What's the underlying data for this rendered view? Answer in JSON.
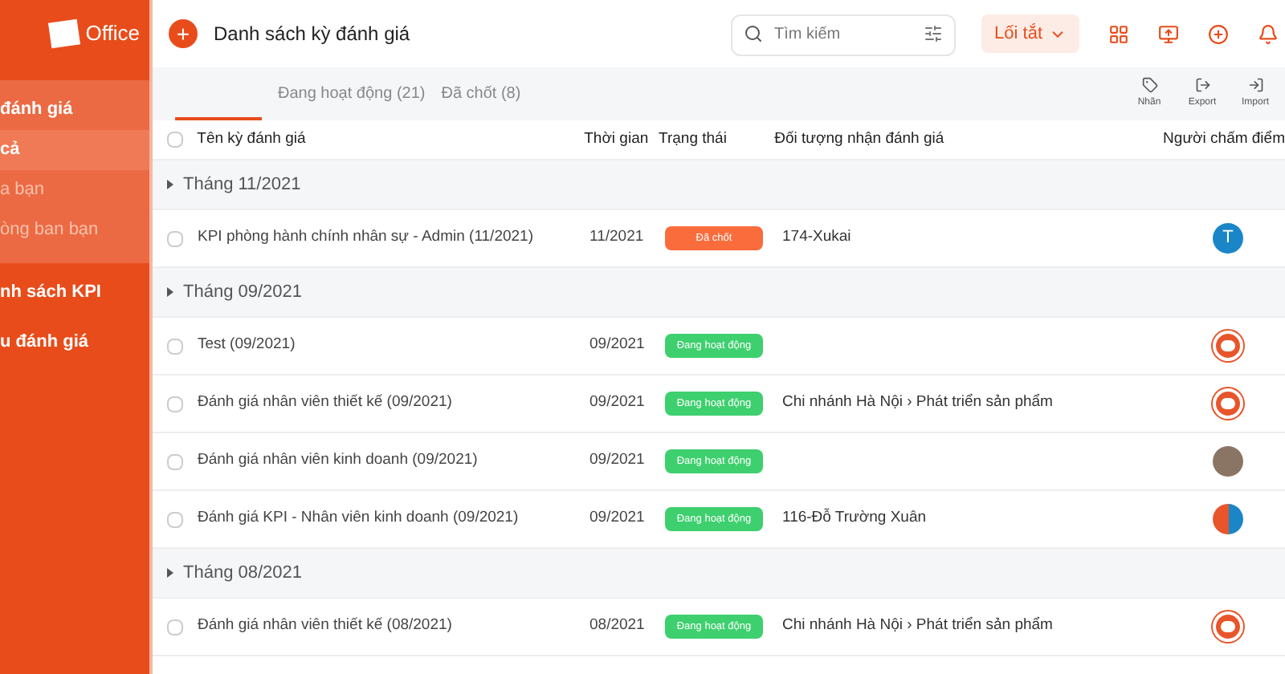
{
  "sidebar": {
    "logo_text": "Office",
    "items": [
      {
        "label": "đánh giá",
        "selected": false,
        "faded": false,
        "bold": true,
        "children": [
          {
            "label": "cả",
            "selected": true,
            "faded": false,
            "bold": true
          },
          {
            "label": "a bạn",
            "selected": false,
            "faded": true,
            "bold": false
          },
          {
            "label": "òng ban bạn",
            "selected": false,
            "faded": true,
            "bold": false
          }
        ]
      },
      {
        "label": "nh sách KPI",
        "selected": false,
        "faded": false,
        "bold": true
      },
      {
        "label": "u đánh giá",
        "selected": false,
        "faded": false,
        "bold": true
      }
    ]
  },
  "header": {
    "add_icon": "+",
    "title": "Danh sách kỳ đánh giá",
    "search": {
      "placeholder": "Tìm kiếm"
    },
    "shortcut_button": "Lối tắt"
  },
  "tabs": [
    {
      "selected": true
    },
    {
      "label": "Đang hoạt động (21)",
      "selected": false
    },
    {
      "label": "Đã chốt (8)",
      "selected": false
    }
  ],
  "toolbar_actions": [
    {
      "kind": "tag",
      "label": "Nhãn"
    },
    {
      "kind": "export",
      "label": "Export"
    },
    {
      "kind": "import",
      "label": "Import"
    }
  ],
  "table": {
    "select_all_checked": false,
    "columns": [
      "Tên kỳ đánh giá",
      "Thời gian",
      "Trạng thái",
      "Đối tượng nhận đánh giá",
      "Người chấm điểm"
    ],
    "groups": [
      {
        "title": "Tháng 11/2021",
        "expanded": true,
        "rows": [
          {
            "checked": false,
            "name": "KPI phòng hành chính nhân sự - Admin (11/2021)",
            "time": "11/2021",
            "status": {
              "kind": "closed",
              "label": "Đã chốt"
            },
            "target": "174-Xukai",
            "scorer": {
              "kind": "letter",
              "letter": "T"
            }
          }
        ]
      },
      {
        "title": "Tháng 09/2021",
        "expanded": true,
        "rows": [
          {
            "checked": false,
            "name": "Test (09/2021)",
            "time": "09/2021",
            "status": {
              "kind": "active",
              "label": "Đang hoạt động"
            },
            "scorer": {
              "kind": "logo"
            }
          },
          {
            "checked": false,
            "name": "Đánh giá nhân viên thiết kế (09/2021)",
            "time": "09/2021",
            "status": {
              "kind": "active",
              "label": "Đang hoạt động"
            },
            "target": "Chi nhánh Hà Nội › Phát triển sản phẩm",
            "scorer": {
              "kind": "logo"
            }
          },
          {
            "checked": false,
            "name": "Đánh giá nhân viên kinh doanh (09/2021)",
            "time": "09/2021",
            "status": {
              "kind": "active",
              "label": "Đang hoạt động"
            },
            "scorer": {
              "kind": "photo"
            }
          },
          {
            "checked": false,
            "name": "Đánh giá KPI - Nhân viên kinh doanh (09/2021)",
            "time": "09/2021",
            "status": {
              "kind": "active",
              "label": "Đang hoạt động"
            },
            "target": "116-Đỗ Trường Xuân",
            "scorer": {
              "kind": "split"
            }
          }
        ]
      },
      {
        "title": "Tháng 08/2021",
        "expanded": true,
        "rows": [
          {
            "checked": false,
            "name": "Đánh giá nhân viên thiết kế (08/2021)",
            "time": "08/2021",
            "status": {
              "kind": "active",
              "label": "Đang hoạt động"
            },
            "target": "Chi nhánh Hà Nội › Phát triển sản phẩm",
            "scorer": {
              "kind": "logo"
            }
          }
        ]
      }
    ]
  }
}
